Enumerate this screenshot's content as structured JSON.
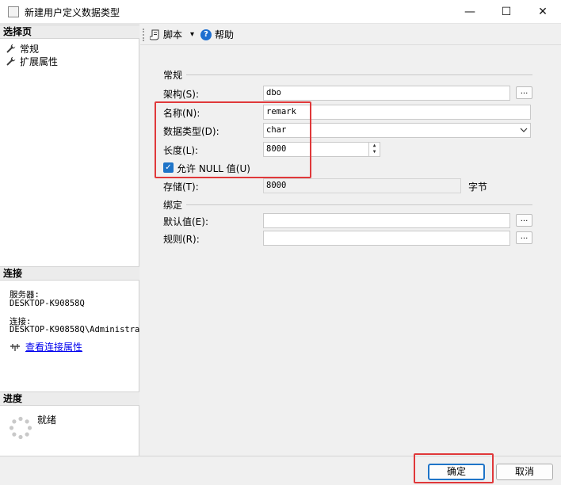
{
  "window": {
    "title": "新建用户定义数据类型",
    "minimize_glyph": "—",
    "maximize_glyph": "☐",
    "close_glyph": "✕"
  },
  "left": {
    "select_page_header": "选择页",
    "pages": [
      {
        "label": "常规",
        "icon": "wrench-icon"
      },
      {
        "label": "扩展属性",
        "icon": "wrench-icon"
      }
    ],
    "connection_header": "连接",
    "server_label": "服务器:",
    "server_value": "DESKTOP-K90858Q",
    "connection_label": "连接:",
    "connection_value": "DESKTOP-K90858Q\\Administrat",
    "view_connection_props": "查看连接属性",
    "progress_header": "进度",
    "progress_status": "就绪"
  },
  "toolbar": {
    "script_label": "脚本",
    "script_dropdown_glyph": "▾",
    "help_label": "帮助",
    "help_glyph": "?"
  },
  "form": {
    "general_title": "常规",
    "schema_label": "架构(S):",
    "schema_value": "dbo",
    "browse_glyph": "...",
    "name_label": "名称(N):",
    "name_value": "remark",
    "datatype_label": "数据类型(D):",
    "datatype_value": "char",
    "length_label": "长度(L):",
    "length_value": "8000",
    "allow_null_label": "允许 NULL 值(U)",
    "allow_null_checked": true,
    "storage_label": "存储(T):",
    "storage_value": "8000",
    "storage_unit": "字节",
    "binding_title": "绑定",
    "default_label": "默认值(E):",
    "default_value": "",
    "rule_label": "规则(R):",
    "rule_value": ""
  },
  "buttons": {
    "ok_label": "确定",
    "cancel_label": "取消"
  },
  "colors": {
    "highlight_red": "#e0383a",
    "accent_blue": "#1e74c8",
    "link_blue": "#0000ee"
  }
}
